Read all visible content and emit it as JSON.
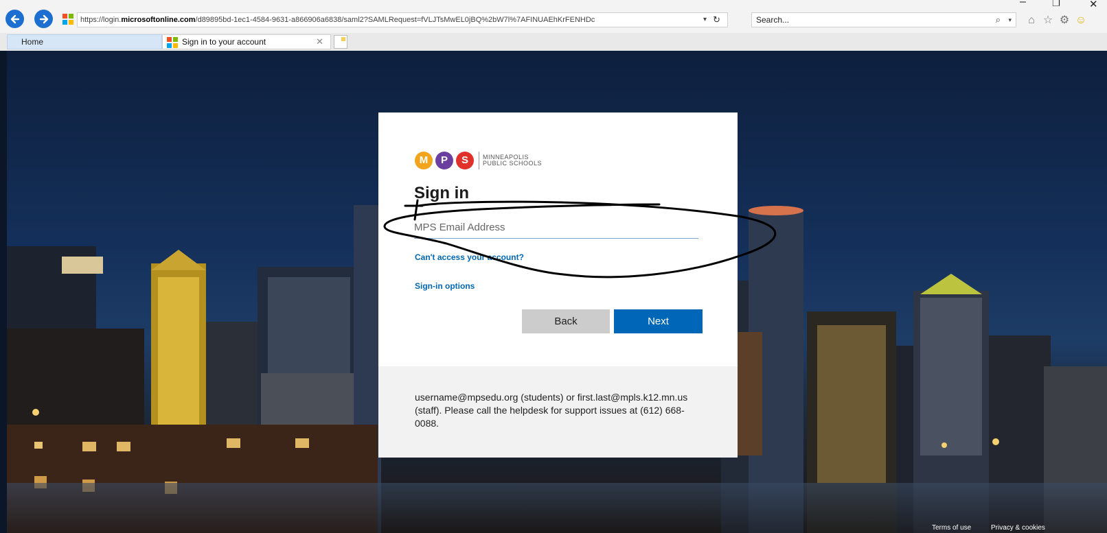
{
  "browser": {
    "url_prefix": "https://login.",
    "url_host": "microsoftonline.com",
    "url_rest": "/d89895bd-1ec1-4584-9631-a866906a6838/saml2?SAMLRequest=fVLJTsMwEL0jBQ%2bW7l%7AFINUAEhKrFENHDc",
    "search_placeholder": "Search...",
    "tabs": [
      {
        "label": "Home"
      },
      {
        "label": "Sign in to your account"
      }
    ]
  },
  "logo": {
    "letters": [
      "M",
      "P",
      "S"
    ],
    "text_line1": "MINNEAPOLIS",
    "text_line2": "PUBLIC SCHOOLS",
    "colors": [
      "#f2a51c",
      "#6b3fa0",
      "#e0312b"
    ]
  },
  "signin": {
    "title": "Sign in",
    "email_placeholder": "MPS Email Address",
    "cant_access": "Can't access your account?",
    "options": "Sign-in options",
    "back_label": "Back",
    "next_label": "Next",
    "footer_text": "username@mpsedu.org (students) or first.last@mpls.k12.mn.us (staff). Please call the helpdesk for support issues at (612) 668-0088."
  },
  "page_footer": {
    "terms": "Terms of use",
    "privacy": "Privacy & cookies"
  },
  "colors": {
    "accent": "#0067b8",
    "browser_nav": "#1c6fd0"
  }
}
